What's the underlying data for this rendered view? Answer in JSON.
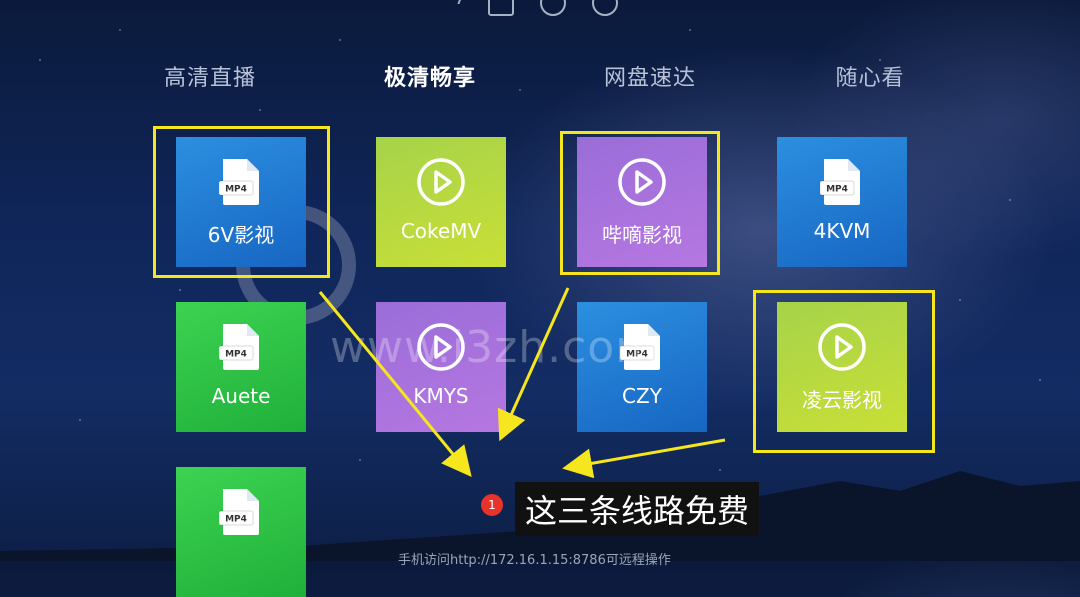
{
  "tabs": [
    {
      "label": "高清直播",
      "active": false
    },
    {
      "label": "极清畅享",
      "active": true
    },
    {
      "label": "网盘速达",
      "active": false
    },
    {
      "label": "随心看",
      "active": false
    }
  ],
  "tiles": [
    {
      "label": "6V影视",
      "icon": "mp4-file-icon",
      "color": "blue"
    },
    {
      "label": "CokeMV",
      "icon": "play-icon",
      "color": "lime"
    },
    {
      "label": "哔嘀影视",
      "icon": "play-icon",
      "color": "purple"
    },
    {
      "label": "4KVM",
      "icon": "mp4-file-icon",
      "color": "blue"
    },
    {
      "label": "Auete",
      "icon": "mp4-file-icon",
      "color": "green"
    },
    {
      "label": "KMYS",
      "icon": "play-icon",
      "color": "purple"
    },
    {
      "label": "CZY",
      "icon": "mp4-file-icon",
      "color": "blue"
    },
    {
      "label": "凌云影视",
      "icon": "play-icon",
      "color": "lime"
    },
    {
      "label": "",
      "icon": "mp4-file-icon",
      "color": "green"
    }
  ],
  "mp4_text": "MP4",
  "annotation": {
    "badge": "1",
    "text": "这三条线路免费",
    "highlight_color": "#f5e61e"
  },
  "footer": "手机访问http://172.16.1.15:8786可远程操作",
  "watermark": "www.i3zh.com"
}
